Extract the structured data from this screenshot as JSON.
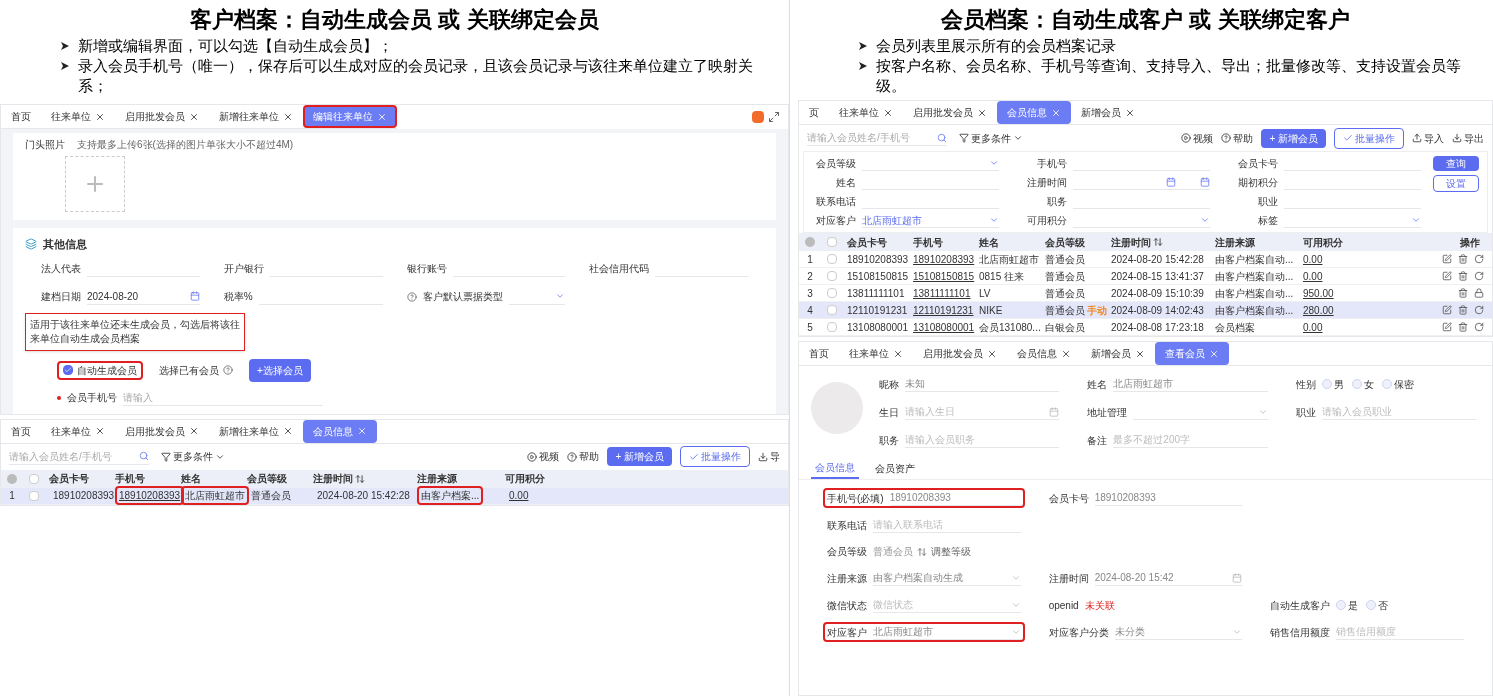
{
  "left": {
    "title": "客户档案：自动生成会员 或 关联绑定会员",
    "bullets": [
      "新增或编辑界面，可以勾选【自动生成会员】；",
      "录入会员手机号（唯一），保存后可以生成对应的会员记录，且该会员记录与该往来单位建立了映射关系；"
    ],
    "edit_screen": {
      "tabs": [
        {
          "label": "首页",
          "selected": false,
          "closable": false,
          "highlighted": false
        },
        {
          "label": "往来单位",
          "selected": false,
          "closable": true,
          "highlighted": false
        },
        {
          "label": "启用批发会员",
          "selected": false,
          "closable": true,
          "highlighted": false
        },
        {
          "label": "新增往来单位",
          "selected": false,
          "closable": true,
          "highlighted": false
        },
        {
          "label": "编辑往来单位",
          "selected": true,
          "closable": true,
          "highlighted": true
        }
      ],
      "photo_label": "门头照片",
      "photo_hint": "支持最多上传6张(选择的图片单张大小不超过4M)",
      "section_title": "其他信息",
      "fields": [
        {
          "kind": "text",
          "label": "法人代表"
        },
        {
          "kind": "text",
          "label": "开户银行"
        },
        {
          "kind": "text",
          "label": "银行账号"
        },
        {
          "kind": "text",
          "label": "社会信用代码"
        },
        {
          "kind": "date",
          "label": "建档日期",
          "value": "2024-08-20"
        },
        {
          "kind": "text",
          "label": "税率%"
        },
        {
          "kind": "select_help",
          "label": "客户默认票据类型"
        }
      ],
      "note": "适用于该往来单位还未生成会员，勾选后将该往来单位自动生成会员档案",
      "auto_member": {
        "label": "自动生成会员",
        "checked": true,
        "highlighted": true
      },
      "choose_existing": "选择已有会员",
      "choose_button": "+选择会员",
      "phone_field": {
        "label": "会员手机号",
        "placeholder": "请输入",
        "required": true
      }
    },
    "list_screen": {
      "tabs": [
        {
          "label": "首页",
          "selected": false,
          "closable": false,
          "highlighted": false
        },
        {
          "label": "往来单位",
          "selected": false,
          "closable": true,
          "highlighted": false
        },
        {
          "label": "启用批发会员",
          "selected": false,
          "closable": true,
          "highlighted": false
        },
        {
          "label": "新增往来单位",
          "selected": false,
          "closable": true,
          "highlighted": false
        },
        {
          "label": "会员信息",
          "selected": true,
          "closable": true,
          "highlighted": false
        }
      ],
      "search_placeholder": "请输入会员姓名/手机号",
      "more_filters": "更多条件",
      "video": "视频",
      "help": "帮助",
      "add_button": "+ 新增会员",
      "batch_button": "批量操作",
      "export_cut": "导",
      "all_checked": false,
      "columns": [
        {
          "label": "会员卡号",
          "kind": "plain"
        },
        {
          "label": "手机号",
          "kind": "link"
        },
        {
          "label": "姓名",
          "kind": "plain"
        },
        {
          "label": "会员等级",
          "kind": "plain"
        },
        {
          "label": "注册时间",
          "kind": "sorted"
        },
        {
          "label": "注册来源",
          "kind": "plain"
        },
        {
          "label": "可用积分",
          "kind": "link"
        }
      ],
      "rows": [
        {
          "index": "1",
          "checked": false,
          "selected": true,
          "cells": [
            {
              "text": "18910208393",
              "highlighted": false
            },
            {
              "text": "18910208393",
              "highlighted": true
            },
            {
              "text": "北店雨虹超市",
              "highlighted": true
            },
            {
              "text": "普通会员",
              "highlighted": false
            },
            {
              "text": "2024-08-20 15:42:28",
              "highlighted": false
            },
            {
              "text": "由客户档案...",
              "highlighted": true
            },
            {
              "text": "0.00",
              "highlighted": false
            }
          ]
        }
      ]
    }
  },
  "right": {
    "title": "会员档案：自动生成客户 或 关联绑定客户",
    "bullets": [
      "会员列表里展示所有的会员档案记录",
      "按客户名称、会员名称、手机号等查询、支持导入、导出；批量修改等、支持设置会员等级。"
    ],
    "list_screen": {
      "tabs": [
        {
          "label": "页",
          "selected": false,
          "closable": false,
          "highlighted": false
        },
        {
          "label": "往来单位",
          "selected": false,
          "closable": true,
          "highlighted": false
        },
        {
          "label": "启用批发会员",
          "selected": false,
          "closable": true,
          "highlighted": false
        },
        {
          "label": "会员信息",
          "selected": true,
          "closable": true,
          "highlighted": false
        },
        {
          "label": "新增会员",
          "selected": false,
          "closable": true,
          "highlighted": false
        }
      ],
      "search_placeholder": "请输入会员姓名/手机号",
      "more_filters": "更多条件",
      "video": "视频",
      "help": "帮助",
      "add_button": "+ 新增会员",
      "batch_button": "批量操作",
      "import": "导入",
      "export": "导出",
      "filters": [
        {
          "kind": "select",
          "label": "会员等级"
        },
        {
          "kind": "text",
          "label": "手机号"
        },
        {
          "kind": "text",
          "label": "会员卡号"
        },
        {
          "kind": "text",
          "label": "姓名"
        },
        {
          "kind": "daterange",
          "label": "注册时间"
        },
        {
          "kind": "text",
          "label": "期初积分"
        },
        {
          "kind": "text",
          "label": "联系电话"
        },
        {
          "kind": "text",
          "label": "职务"
        },
        {
          "kind": "text",
          "label": "职业"
        },
        {
          "kind": "select",
          "label": "对应客户",
          "value": "北店雨虹超市"
        },
        {
          "kind": "select",
          "label": "可用积分"
        },
        {
          "kind": "select",
          "label": "标签"
        }
      ],
      "query_button": "查询",
      "settings_button": "设置",
      "all_checked": false,
      "columns": [
        {
          "label": "会员卡号",
          "kind": "plain"
        },
        {
          "label": "手机号",
          "kind": "link"
        },
        {
          "label": "姓名",
          "kind": "plain"
        },
        {
          "label": "会员等级",
          "kind": "plain"
        },
        {
          "label": "注册时间",
          "kind": "sorted"
        },
        {
          "label": "注册来源",
          "kind": "plain"
        },
        {
          "label": "可用积分",
          "kind": "link"
        }
      ],
      "actions_label": "操作",
      "rows": [
        {
          "index": "1",
          "checked": false,
          "selected": false,
          "locked": false,
          "cells": [
            "18910208393",
            "18910208393",
            "北店雨虹超市",
            "普通会员",
            "2024-08-20 15:42:28",
            "由客户档案自动...",
            "0.00"
          ]
        },
        {
          "index": "2",
          "checked": false,
          "selected": false,
          "locked": false,
          "cells": [
            "15108150815",
            "15108150815",
            "0815 往来",
            "普通会员",
            "2024-08-15 13:41:37",
            "由客户档案自动...",
            "0.00"
          ]
        },
        {
          "index": "3",
          "checked": false,
          "selected": false,
          "locked": true,
          "cells": [
            "13811111101",
            "13811111101",
            "LV",
            "普通会员",
            "2024-08-09 15:10:39",
            "由客户档案自动...",
            "950.00"
          ]
        },
        {
          "index": "4",
          "checked": false,
          "selected": true,
          "locked": false,
          "tag": "手动",
          "cells": [
            "12110191231",
            "12110191231",
            "NIKE",
            "普通会员",
            "2024-08-09 14:02:43",
            "由客户档案自动...",
            "280.00"
          ]
        },
        {
          "index": "5",
          "checked": false,
          "selected": false,
          "locked": false,
          "cells": [
            "13108080001",
            "13108080001",
            "会员131080...",
            "白银会员",
            "2024-08-08 17:23:18",
            "会员档案",
            "0.00"
          ]
        }
      ]
    },
    "detail_screen": {
      "tabs": [
        {
          "label": "首页",
          "selected": false,
          "closable": false,
          "highlighted": false
        },
        {
          "label": "往来单位",
          "selected": false,
          "closable": true,
          "highlighted": false
        },
        {
          "label": "启用批发会员",
          "selected": false,
          "closable": true,
          "highlighted": false
        },
        {
          "label": "会员信息",
          "selected": false,
          "closable": true,
          "highlighted": false
        },
        {
          "label": "新增会员",
          "selected": false,
          "closable": true,
          "highlighted": false
        },
        {
          "label": "查看会员",
          "selected": true,
          "closable": true,
          "highlighted": false
        }
      ],
      "profile_fields": [
        {
          "kind": "text",
          "label": "昵称",
          "value": "未知",
          "highlighted": false
        },
        {
          "kind": "text",
          "label": "姓名",
          "value": "北店雨虹超市",
          "highlighted": false
        },
        {
          "kind": "radio",
          "label": "性别",
          "options": [
            {
              "label": "男",
              "selected": false
            },
            {
              "label": "女",
              "selected": false
            },
            {
              "label": "保密",
              "selected": false
            }
          ],
          "highlighted": false
        },
        {
          "kind": "date",
          "label": "生日",
          "placeholder": "请输入生日",
          "highlighted": false
        },
        {
          "kind": "select",
          "label": "地址管理",
          "highlighted": false
        },
        {
          "kind": "text",
          "label": "职业",
          "placeholder": "请输入会员职业",
          "highlighted": false
        },
        {
          "kind": "text",
          "label": "职务",
          "placeholder": "请输入会员职务",
          "highlighted": false
        },
        {
          "kind": "text",
          "label": "备注",
          "placeholder": "最多不超过200字",
          "highlighted": false
        }
      ],
      "sub_tabs": [
        {
          "label": "会员信息",
          "selected": true
        },
        {
          "label": "会员资产",
          "selected": false
        }
      ],
      "member_fields": [
        {
          "kind": "text",
          "label": "手机号(必填)",
          "value": "18910208393",
          "highlighted": true
        },
        {
          "kind": "text",
          "label": "会员卡号",
          "value": "18910208393",
          "highlighted": false
        },
        {
          "kind": "spacer"
        },
        {
          "kind": "text",
          "label": "联系电话",
          "placeholder": "请输入联系电话",
          "highlighted": false
        },
        {
          "kind": "spacer"
        },
        {
          "kind": "spacer"
        },
        {
          "kind": "level",
          "label": "会员等级",
          "value": "普通会员",
          "link": "调整等级",
          "highlighted": false
        },
        {
          "kind": "spacer"
        },
        {
          "kind": "spacer"
        },
        {
          "kind": "select",
          "label": "注册来源",
          "value": "由客户档案自动生成",
          "highlighted": false
        },
        {
          "kind": "date",
          "label": "注册时间",
          "value": "2024-08-20 15:42",
          "highlighted": false
        },
        {
          "kind": "spacer"
        },
        {
          "kind": "select",
          "label": "微信状态",
          "placeholder": "微信状态",
          "highlighted": false
        },
        {
          "kind": "status",
          "label": "openid",
          "value": "未关联",
          "highlighted": false
        },
        {
          "kind": "radio",
          "label": "自动生成客户",
          "options": [
            {
              "label": "是",
              "selected": false
            },
            {
              "label": "否",
              "selected": false
            }
          ],
          "highlighted": false
        },
        {
          "kind": "select",
          "label": "对应客户",
          "value": "北店雨虹超市",
          "highlighted": true
        },
        {
          "kind": "select",
          "label": "对应客户分类",
          "value": "未分类",
          "highlighted": false
        },
        {
          "kind": "text",
          "label": "销售信用额度",
          "placeholder": "销售信用额度",
          "highlighted": false
        }
      ]
    }
  }
}
